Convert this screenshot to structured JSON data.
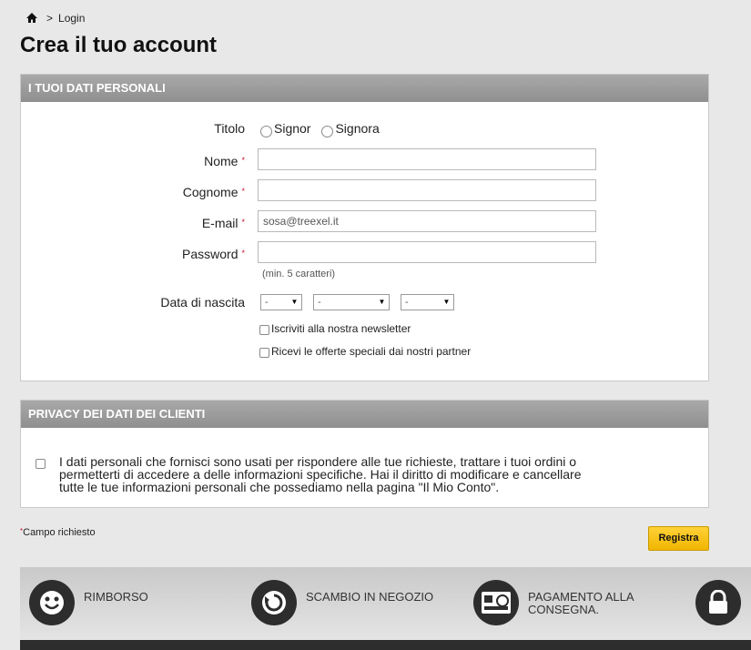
{
  "breadcrumb": {
    "separator": ">",
    "current": "Login"
  },
  "page_title": "Crea il tuo account",
  "personal": {
    "header": "I TUOI DATI PERSONALI",
    "title_label": "Titolo",
    "title_options": [
      "Signor",
      "Signora"
    ],
    "first_name_label": "Nome",
    "last_name_label": "Cognome",
    "email_label": "E-mail",
    "email_value": "sosa@treexel.it",
    "password_label": "Password",
    "password_hint": "(min. 5 caratteri)",
    "birth_label": "Data di nascita",
    "birth_day": "-",
    "birth_month": "-",
    "birth_year": "-",
    "newsletter_label": "Iscriviti alla nostra newsletter",
    "partners_label": "Ricevi le offerte speciali dai nostri partner",
    "required_mark": "*"
  },
  "privacy": {
    "header": "PRIVACY DEI DATI DEI CLIENTI",
    "text": "I dati personali che fornisci sono usati per rispondere alle tue richieste, trattare i tuoi ordini o permetterti di accedere a delle informazioni specifiche. Hai il diritto di modificare e cancellare tutte le tue informazioni personali che possediamo nella pagina \"Il Mio Conto\"."
  },
  "required_note": "Campo richiesto",
  "register_label": "Registra",
  "features": [
    {
      "icon": "smile-icon",
      "label": "RIMBORSO"
    },
    {
      "icon": "refresh-icon",
      "label": "SCAMBIO IN NEGOZIO"
    },
    {
      "icon": "cash-icon",
      "label": "PAGAMENTO ALLA CONSEGNA."
    },
    {
      "icon": "lock-icon",
      "label": ""
    }
  ],
  "colors": {
    "accent": "#f5c000",
    "header_gray": "#9b9b9b",
    "required": "#c8102e"
  }
}
